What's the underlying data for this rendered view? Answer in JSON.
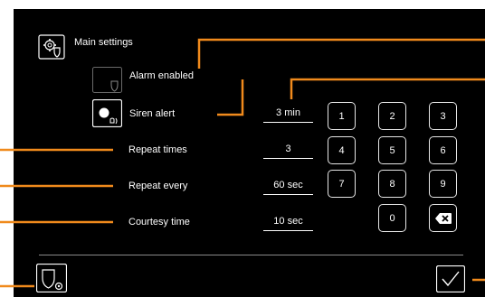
{
  "header": {
    "title": "Main settings",
    "icon": "settings-shield-icon"
  },
  "alarm": {
    "label": "Alarm enabled",
    "checked": false
  },
  "siren": {
    "label": "Siren alert",
    "value": "3 min",
    "checked": true
  },
  "repeat_times": {
    "label": "Repeat times",
    "value": "3"
  },
  "repeat_every": {
    "label": "Repeat every",
    "value": "60 sec"
  },
  "courtesy": {
    "label": "Courtesy time",
    "value": "10 sec"
  },
  "keypad": {
    "keys": [
      "1",
      "2",
      "3",
      "4",
      "5",
      "6",
      "7",
      "8",
      "9",
      "0"
    ],
    "backspace_icon": "backspace-icon"
  },
  "footer": {
    "left_icon": "shield-settings-icon",
    "right_icon": "confirm-check-icon"
  },
  "colors": {
    "background": "#000000",
    "text": "#ffffff",
    "callout": "#f08a1c"
  }
}
